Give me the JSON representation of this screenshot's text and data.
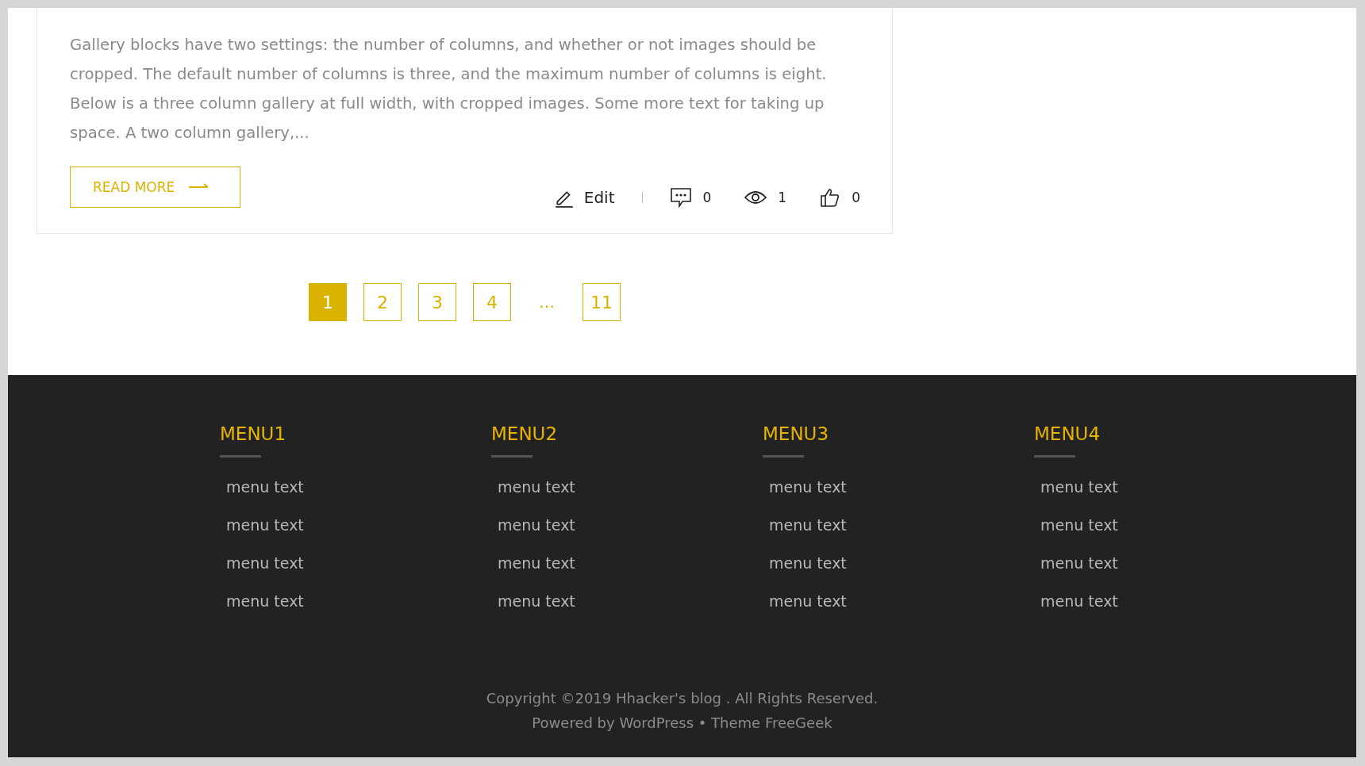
{
  "post": {
    "excerpt": "Gallery blocks have two settings: the number of columns, and whether or not images should be cropped. The default number of columns is three, and the maximum number of columns is eight. Below is a three column gallery at full width, with cropped images. Some more text for taking up space. A two column gallery,...",
    "read_more": "READ MORE",
    "edit": "Edit",
    "comments": "0",
    "views": "1",
    "likes": "0"
  },
  "pagination": [
    {
      "kind": "page",
      "label": "1",
      "selected": true
    },
    {
      "kind": "page",
      "label": "2",
      "selected": false
    },
    {
      "kind": "page",
      "label": "3",
      "selected": false
    },
    {
      "kind": "page",
      "label": "4",
      "selected": false
    },
    {
      "kind": "ellipsis",
      "label": "…"
    },
    {
      "kind": "page",
      "label": "11",
      "selected": false
    }
  ],
  "footer": {
    "menus": [
      {
        "title": "MENU1",
        "items": [
          "menu text",
          "menu text",
          "menu text",
          "menu text"
        ]
      },
      {
        "title": "MENU2",
        "items": [
          "menu text",
          "menu text",
          "menu text",
          "menu text"
        ]
      },
      {
        "title": "MENU3",
        "items": [
          "menu text",
          "menu text",
          "menu text",
          "menu text"
        ]
      },
      {
        "title": "MENU4",
        "items": [
          "menu text",
          "menu text",
          "menu text",
          "menu text"
        ]
      }
    ],
    "copyright": "Copyright ©2019 Hhacker's blog . All Rights Reserved.",
    "powered": "Powered by WordPress • Theme FreeGeek"
  }
}
